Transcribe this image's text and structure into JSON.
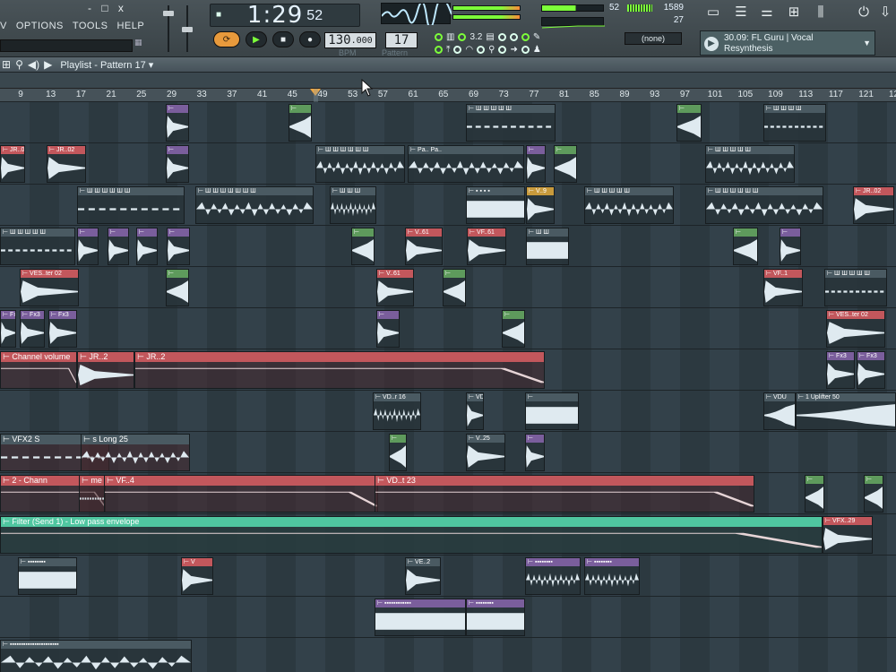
{
  "window": {
    "controls": "- □ x"
  },
  "menu": [
    "V",
    "OPTIONS",
    "TOOLS",
    "HELP"
  ],
  "time": {
    "prefix": "■",
    "main": "1:29",
    "sub": "52"
  },
  "tempo": {
    "value": "130",
    "decimal": ".000",
    "label": "BPM"
  },
  "pattern": {
    "value": "17",
    "label": "Pattern"
  },
  "cpu": {
    "value1": "52",
    "value2": "1589",
    "value3": "27"
  },
  "snap": {
    "value": "3.2"
  },
  "pattern_select": {
    "value": "(none)"
  },
  "hint_panel": {
    "line1": "30.09: FL Guru | Vocal",
    "line2": "Resynthesis"
  },
  "playlist": {
    "title": "Playlist - Pattern 17 ▾"
  },
  "ruler": [
    "9",
    "13",
    "17",
    "21",
    "25",
    "29",
    "33",
    "37",
    "41",
    "45",
    "49",
    "53",
    "57",
    "61",
    "65",
    "69",
    "73",
    "77",
    "81",
    "85",
    "89",
    "93",
    "97",
    "101",
    "105",
    "109",
    "113",
    "117",
    "121",
    "125"
  ],
  "playhead": {
    "bar": "49"
  },
  "track_labels": {
    "l1": [
      "JR..02",
      "JR..02"
    ],
    "l3": [
      "JR..02"
    ],
    "l4": [
      "V..61",
      "VF..61"
    ],
    "l5": [
      "VES..ter 02",
      "V..61",
      "VF..1"
    ],
    "l6": [
      "Fx3",
      "Fx3",
      "Fx3",
      "VES..ter 02"
    ],
    "l7": [
      "Channel volume",
      "JR..2",
      "JR..2",
      "Fx3",
      "Fx3"
    ],
    "l8": [
      "VD..r 16",
      "VD",
      "VDU",
      "1 Uplifter 50"
    ],
    "l9": [
      "VFX2 S",
      "s Long 25",
      "V..25"
    ],
    "l10": [
      "2 - Chann",
      "me e",
      "VF..4",
      "VD..t 23"
    ],
    "l11": [
      "Filter (Send 1) - Low pass envelope",
      "VFX..29"
    ],
    "l12": [
      "V",
      "VE..2"
    ]
  },
  "colors": {
    "green": "#5e9a5c",
    "pink": "#c2575c",
    "purple": "#7a5e9c",
    "teal_bar": "#4fc6a0",
    "accent": "#f0a843"
  }
}
